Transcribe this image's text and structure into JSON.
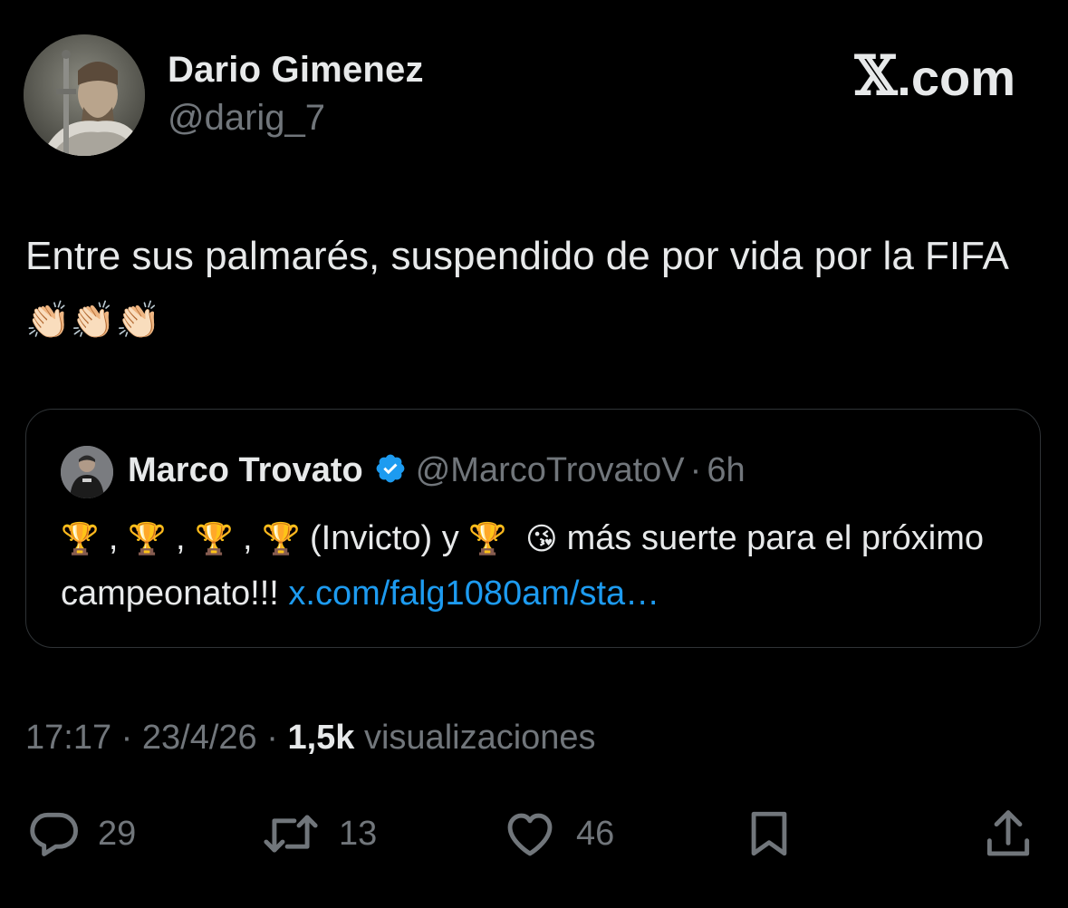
{
  "header": {
    "author_name": "Dario Gimenez",
    "author_handle": "@darig_7",
    "brand_mark": "𝕏",
    "brand_text": ".com"
  },
  "tweet": {
    "text": "Entre sus palmarés, suspendido de por vida por la FIFA",
    "clap": "👏🏻",
    "clap_count": 3
  },
  "quote": {
    "author_name": "Marco Trovato",
    "verified_icon": "verified-badge-icon",
    "author_handle": "@MarcoTrovatoV",
    "separator": "·",
    "time": "6h",
    "trophy": "🏆",
    "comma": ",",
    "invicto": "(Invicto) y",
    "kiss": "😘",
    "text_tail": "más suerte para el próximo campeonato!!!",
    "link": "x.com/falg1080am/sta…"
  },
  "meta": {
    "time": "17:17",
    "sep": "·",
    "date": "23/4/26",
    "views_count": "1,5k",
    "views_label": "visualizaciones"
  },
  "actions": {
    "replies": "29",
    "reposts": "13",
    "likes": "46",
    "icons": [
      "reply-icon",
      "repost-icon",
      "like-icon",
      "bookmark-icon",
      "share-icon"
    ]
  },
  "colors": {
    "background": "#000000",
    "text": "#e7e9ea",
    "secondary": "#71767b",
    "link": "#1d9bf0",
    "border": "#2f3336",
    "verified": "#1d9bf0"
  }
}
